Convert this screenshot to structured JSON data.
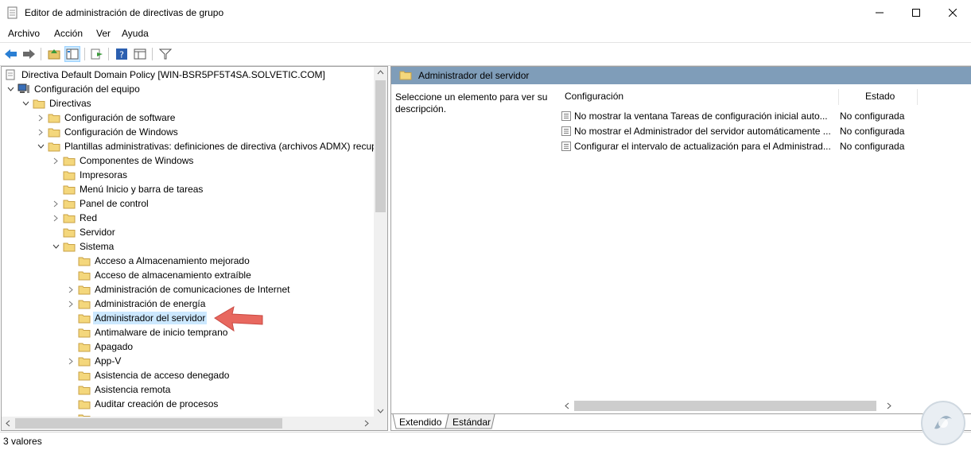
{
  "window": {
    "title": "Editor de administración de directivas de grupo"
  },
  "menu": [
    "Archivo",
    "Acción",
    "Ver",
    "Ayuda"
  ],
  "tree": {
    "root": "Directiva Default Domain Policy [WIN-BSR5PF5T4SA.SOLVETIC.COM]",
    "n1": "Configuración del equipo",
    "n2": "Directivas",
    "n3": "Configuración de software",
    "n4": "Configuración de Windows",
    "n5": "Plantillas administrativas: definiciones de directiva (archivos ADMX) recup",
    "n6": "Componentes de Windows",
    "n7": "Impresoras",
    "n8": "Menú Inicio y barra de tareas",
    "n9": "Panel de control",
    "n10": "Red",
    "n11": "Servidor",
    "n12": "Sistema",
    "n13": "Acceso a Almacenamiento mejorado",
    "n14": "Acceso de almacenamiento extraíble",
    "n15": "Administración de comunicaciones de Internet",
    "n16": "Administración de energía",
    "n17": "Administrador del servidor",
    "n18": "Antimalware de inicio temprano",
    "n19": "Apagado",
    "n20": "App-V",
    "n21": "Asistencia de acceso denegado",
    "n22": "Asistencia remota",
    "n23": "Auditar creación de procesos"
  },
  "right": {
    "header": "Administrador del servidor",
    "description": "Seleccione un elemento para ver su descripción.",
    "col_config": "Configuración",
    "col_state": "Estado",
    "rows": [
      {
        "name": "No mostrar la ventana Tareas de configuración inicial auto...",
        "state": "No configurada"
      },
      {
        "name": "No mostrar el Administrador del servidor automáticamente ...",
        "state": "No configurada"
      },
      {
        "name": "Configurar el intervalo de actualización para el Administrad...",
        "state": "No configurada"
      }
    ],
    "tab_extended": "Extendido",
    "tab_standard": "Estándar"
  },
  "status": {
    "text": "3 valores"
  },
  "colors": {
    "header_bg": "#7f9db9",
    "selection": "#cce8ff",
    "arrow": "#e8685f",
    "folder": "#e8c66b"
  }
}
